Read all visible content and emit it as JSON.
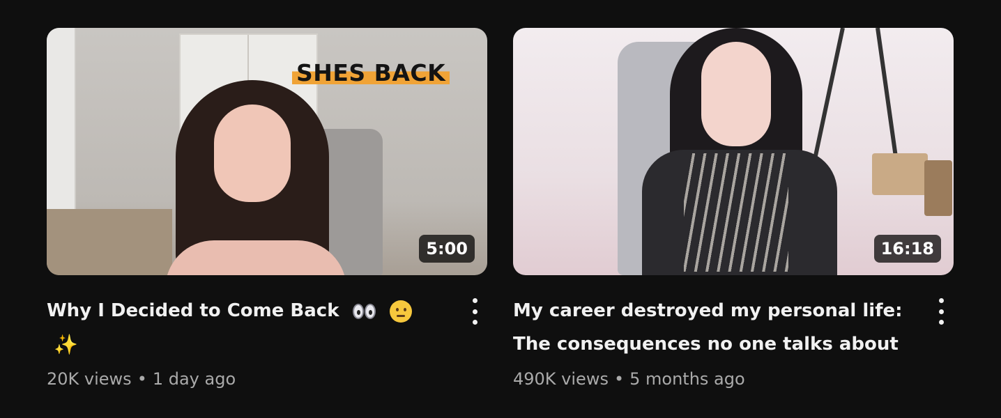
{
  "videos": [
    {
      "thumbnail_text": "SHES BACK",
      "duration": "5:00",
      "title": "Why I Decided to Come Back",
      "title_emojis": [
        "eyes-emoji",
        "thinking-face-emoji",
        "sparkles-emoji"
      ],
      "views": "20K views",
      "separator": "•",
      "age": "1 day ago"
    },
    {
      "duration": "16:18",
      "title": "My career destroyed my personal life: The consequences no one talks about",
      "views": "490K views",
      "separator": "•",
      "age": "5 months ago"
    }
  ],
  "colors": {
    "background": "#0f0f0f",
    "title_text": "#f1f1f1",
    "meta_text": "#aaaaaa",
    "thumbnail_text_highlight": "#f0a336"
  }
}
